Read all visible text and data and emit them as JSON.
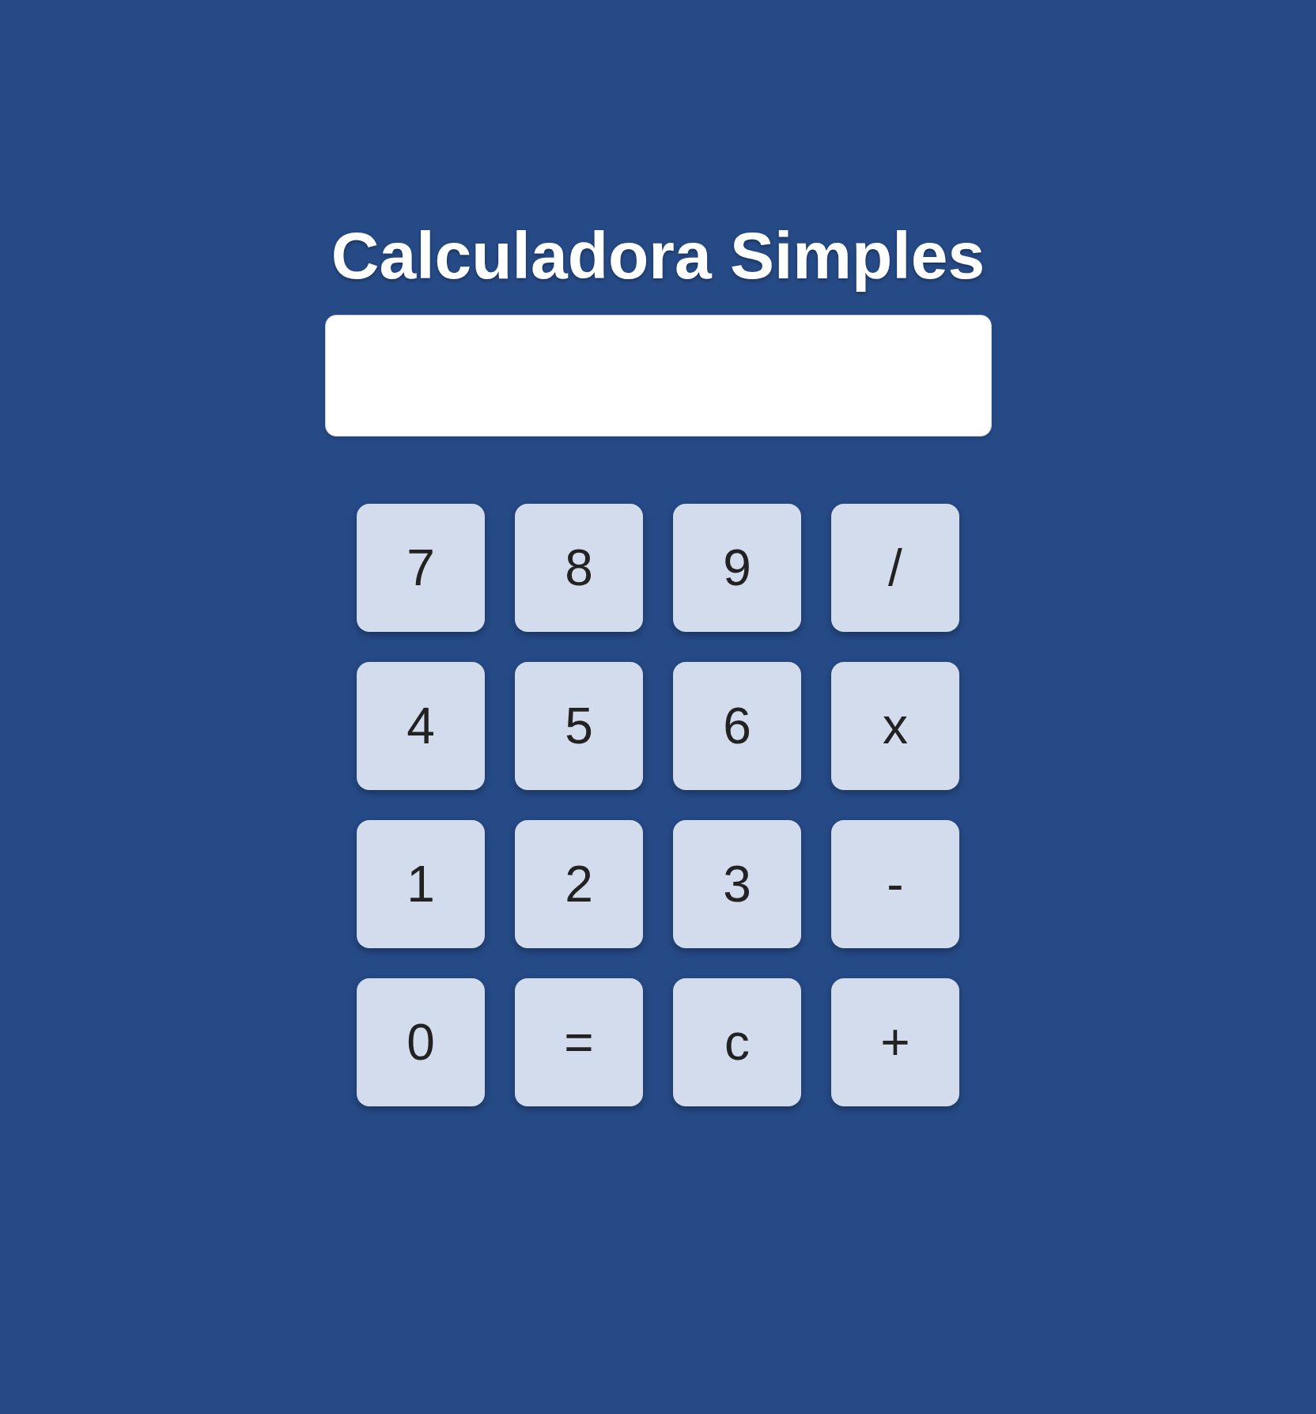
{
  "title": "Calculadora Simples",
  "keys": [
    [
      "7",
      "8",
      "9",
      "/"
    ],
    [
      "4",
      "5",
      "6",
      "x"
    ],
    [
      "1",
      "2",
      "3",
      "-"
    ],
    [
      "0",
      "=",
      "c",
      "+"
    ]
  ]
}
